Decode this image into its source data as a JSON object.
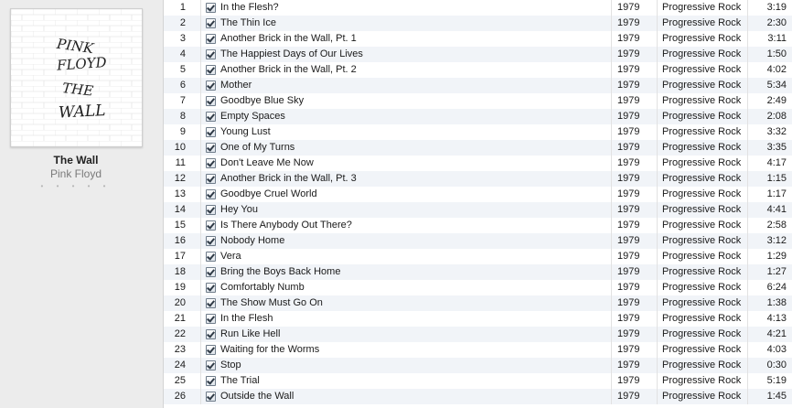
{
  "album": {
    "title": "The Wall",
    "artist": "Pink Floyd",
    "rating_dots": "• • • • •",
    "cover_text": [
      "PINK",
      "FLOYD",
      "THE",
      "WALL"
    ]
  },
  "tracks": [
    {
      "num": "1",
      "name": "In the Flesh?",
      "year": "1979",
      "genre": "Progressive Rock",
      "time": "3:19"
    },
    {
      "num": "2",
      "name": "The Thin Ice",
      "year": "1979",
      "genre": "Progressive Rock",
      "time": "2:30"
    },
    {
      "num": "3",
      "name": "Another Brick in the Wall, Pt. 1",
      "year": "1979",
      "genre": "Progressive Rock",
      "time": "3:11"
    },
    {
      "num": "4",
      "name": "The Happiest Days of Our Lives",
      "year": "1979",
      "genre": "Progressive Rock",
      "time": "1:50"
    },
    {
      "num": "5",
      "name": "Another Brick in the Wall, Pt. 2",
      "year": "1979",
      "genre": "Progressive Rock",
      "time": "4:02"
    },
    {
      "num": "6",
      "name": "Mother",
      "year": "1979",
      "genre": "Progressive Rock",
      "time": "5:34"
    },
    {
      "num": "7",
      "name": "Goodbye Blue Sky",
      "year": "1979",
      "genre": "Progressive Rock",
      "time": "2:49"
    },
    {
      "num": "8",
      "name": "Empty Spaces",
      "year": "1979",
      "genre": "Progressive Rock",
      "time": "2:08"
    },
    {
      "num": "9",
      "name": "Young Lust",
      "year": "1979",
      "genre": "Progressive Rock",
      "time": "3:32"
    },
    {
      "num": "10",
      "name": "One of My Turns",
      "year": "1979",
      "genre": "Progressive Rock",
      "time": "3:35"
    },
    {
      "num": "11",
      "name": "Don't Leave Me Now",
      "year": "1979",
      "genre": "Progressive Rock",
      "time": "4:17"
    },
    {
      "num": "12",
      "name": "Another Brick in the Wall, Pt. 3",
      "year": "1979",
      "genre": "Progressive Rock",
      "time": "1:15"
    },
    {
      "num": "13",
      "name": "Goodbye Cruel World",
      "year": "1979",
      "genre": "Progressive Rock",
      "time": "1:17"
    },
    {
      "num": "14",
      "name": "Hey You",
      "year": "1979",
      "genre": "Progressive Rock",
      "time": "4:41"
    },
    {
      "num": "15",
      "name": "Is There Anybody Out There?",
      "year": "1979",
      "genre": "Progressive Rock",
      "time": "2:58"
    },
    {
      "num": "16",
      "name": "Nobody Home",
      "year": "1979",
      "genre": "Progressive Rock",
      "time": "3:12"
    },
    {
      "num": "17",
      "name": "Vera",
      "year": "1979",
      "genre": "Progressive Rock",
      "time": "1:29"
    },
    {
      "num": "18",
      "name": "Bring the Boys Back Home",
      "year": "1979",
      "genre": "Progressive Rock",
      "time": "1:27"
    },
    {
      "num": "19",
      "name": "Comfortably Numb",
      "year": "1979",
      "genre": "Progressive Rock",
      "time": "6:24"
    },
    {
      "num": "20",
      "name": "The Show Must Go On",
      "year": "1979",
      "genre": "Progressive Rock",
      "time": "1:38"
    },
    {
      "num": "21",
      "name": "In the Flesh",
      "year": "1979",
      "genre": "Progressive Rock",
      "time": "4:13"
    },
    {
      "num": "22",
      "name": "Run Like Hell",
      "year": "1979",
      "genre": "Progressive Rock",
      "time": "4:21"
    },
    {
      "num": "23",
      "name": "Waiting for the Worms",
      "year": "1979",
      "genre": "Progressive Rock",
      "time": "4:03"
    },
    {
      "num": "24",
      "name": "Stop",
      "year": "1979",
      "genre": "Progressive Rock",
      "time": "0:30"
    },
    {
      "num": "25",
      "name": "The Trial",
      "year": "1979",
      "genre": "Progressive Rock",
      "time": "5:19"
    },
    {
      "num": "26",
      "name": "Outside the Wall",
      "year": "1979",
      "genre": "Progressive Rock",
      "time": "1:45"
    }
  ],
  "icons": {
    "checkbox": "checkbox-checked-icon"
  }
}
